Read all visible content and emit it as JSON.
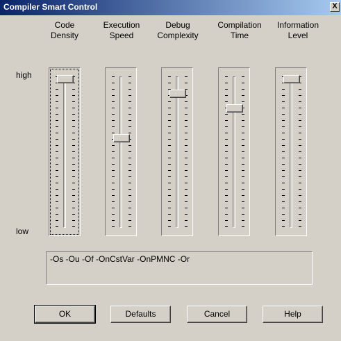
{
  "window": {
    "title": "Compiler Smart Control",
    "close_glyph": "X"
  },
  "scale": {
    "high_label": "high",
    "low_label": "low"
  },
  "sliders": [
    {
      "label": "Code\nDensity",
      "level": 1.0
    },
    {
      "label": "Execution\nSpeed",
      "level": 0.6
    },
    {
      "label": "Debug\nComplexity",
      "level": 0.9
    },
    {
      "label": "Compilation\nTime",
      "level": 0.8
    },
    {
      "label": "Information\nLevel",
      "level": 1.0
    }
  ],
  "options": {
    "text": "-Os -Ou -Of -OnCstVar -OnPMNC -Or"
  },
  "buttons": {
    "ok": "OK",
    "defaults": "Defaults",
    "cancel": "Cancel",
    "help": "Help"
  }
}
